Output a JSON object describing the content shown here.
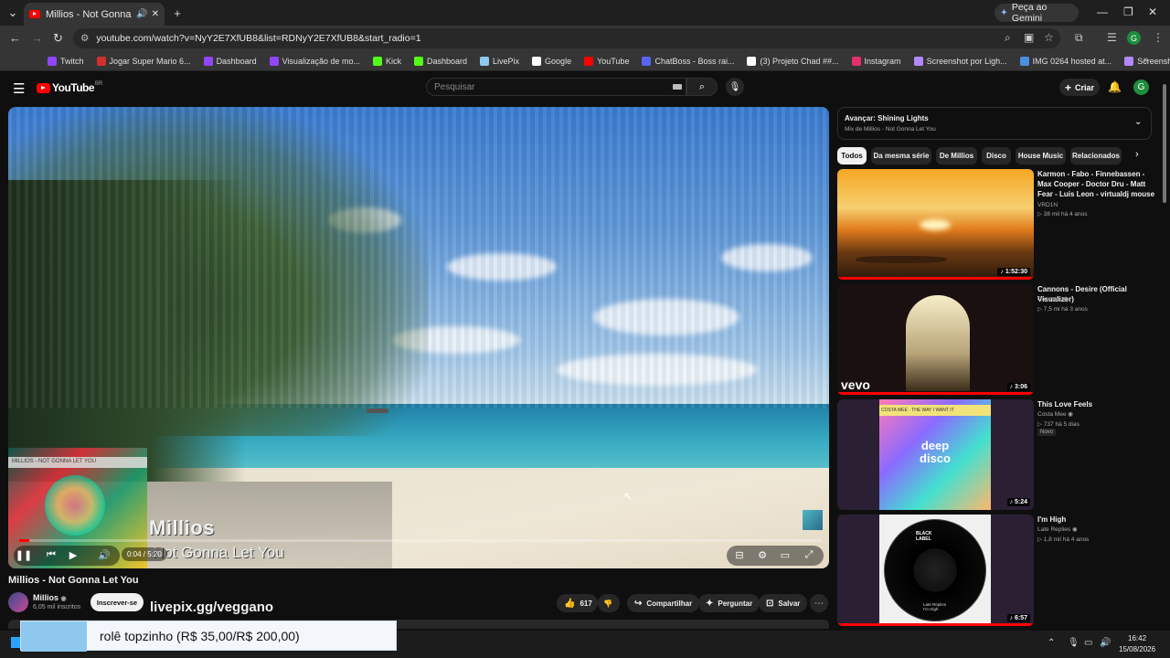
{
  "browser": {
    "tab_title": "Millios - Not Gonna Let You",
    "gemini_label": "Peça ao Gemini",
    "url": "youtube.com/watch?v=NyY2E7XfUB8&list=RDNyY2E7XfUB8&start_radio=1",
    "account_initial": "G",
    "bookmarks": [
      {
        "label": "Twitch",
        "color": "#9146ff"
      },
      {
        "label": "Jogar Super Mario 6...",
        "color": "#d32f2f"
      },
      {
        "label": "Dashboard",
        "color": "#9146ff"
      },
      {
        "label": "Visualização de mo...",
        "color": "#9146ff"
      },
      {
        "label": "Kick",
        "color": "#53fc18"
      },
      {
        "label": "Dashboard",
        "color": "#53fc18"
      },
      {
        "label": "LivePix",
        "color": "#8ec8ee"
      },
      {
        "label": "Google",
        "color": "#ffffff"
      },
      {
        "label": "YouTube",
        "color": "#ff0000"
      },
      {
        "label": "ChatBoss - Boss rai...",
        "color": "#5865f2"
      },
      {
        "label": "(3) Projeto Chad ##...",
        "color": "#ffffff"
      },
      {
        "label": "Instagram",
        "color": "#e1306c"
      },
      {
        "label": "Screenshot por Ligh...",
        "color": "#b388ff"
      },
      {
        "label": "IMG 0264 hosted at...",
        "color": "#4a90e2"
      },
      {
        "label": "Screenshot por Ligh...",
        "color": "#b388ff"
      }
    ]
  },
  "youtube": {
    "logo_text": "YouTube",
    "logo_region": "BR",
    "search_placeholder": "Pesquisar",
    "create_label": "Criar",
    "account_initial": "G"
  },
  "player": {
    "overlay_artist": "Millios",
    "overlay_song": "Not Gonna Let You",
    "thumb_strip": "MILLIOS - NOT GONNA LET YOU",
    "time": "0:04 / 5:20",
    "progress": 0.0125
  },
  "video": {
    "title": "Millios - Not Gonna Let You",
    "channel": "Millios",
    "subscribers": "6,05 mil inscritos",
    "subscribe_label": "Inscrever-se",
    "promo_text": "livepix.gg/veggano",
    "likes": "617",
    "share_label": "Compartilhar",
    "ask_label": "Perguntar",
    "save_label": "Salvar"
  },
  "overlay_banner": {
    "text": "rolê topzinho (R$ 35,00/R$ 200,00)",
    "progress": 0.175
  },
  "sidebar": {
    "playlist_title": "Avançar: Shining Lights",
    "playlist_sub": "Mix de Millios - Not Gonna Let You",
    "chips": [
      "Todos",
      "Da mesma série",
      "De Millios",
      "Disco",
      "House Music",
      "Relacionados"
    ],
    "recommendations": [
      {
        "title": "Karmon - Fabo - Finnebassen - Max Cooper - Doctor Dru - Matt Fear - Luis Leon - virtualdj mouse",
        "channel": "VRD1N",
        "meta": "▷ 38 mil   há 4 anos",
        "duration": "1:52:30"
      },
      {
        "title": "Cannons - Desire (Official Visualizer)",
        "channel": "Cannons",
        "meta": "▷ 7,5 mi   há 3 anos",
        "duration": "3:06",
        "brand": "vevo"
      },
      {
        "title": "This Love Feels",
        "channel": "Costa Mee",
        "meta": "▷ 737   há 5 dias",
        "duration": "5:24",
        "badge": "Novo",
        "thumb_header": "COSTA MEE · THE WAY I WANT IT",
        "thumb_logo": "deep disco"
      },
      {
        "title": "I'm High",
        "channel": "Late Replies",
        "meta": "▷ 1,8 mil   há 4 anos",
        "duration": "6:57",
        "thumb_label": "BLACK LABEL",
        "thumb_caption": "Late Replies\nI'm High"
      }
    ]
  },
  "system": {
    "time": "16:42",
    "date": "15/08/2026"
  }
}
